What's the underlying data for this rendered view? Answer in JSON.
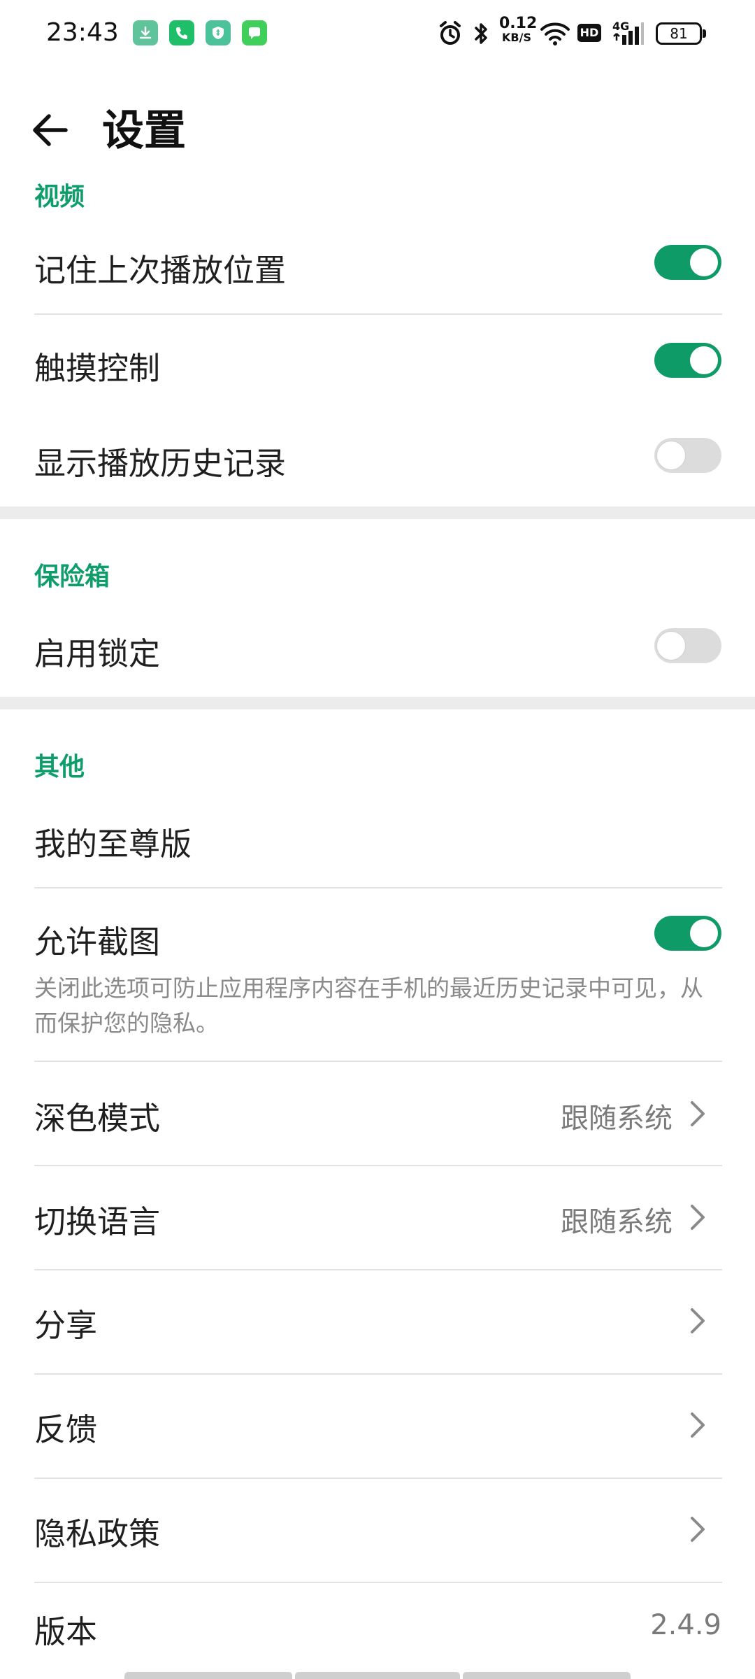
{
  "status_bar": {
    "time": "23:43",
    "notification_icons": [
      {
        "name": "download-icon",
        "color": "#5fc49a"
      },
      {
        "name": "phone-icon",
        "color": "#1fbf6a"
      },
      {
        "name": "security-shield-icon",
        "color": "#4cc29a"
      },
      {
        "name": "message-icon",
        "color": "#3fcf5a"
      }
    ],
    "net_speed_value": "0.12",
    "net_speed_unit": "KB/S",
    "hd_label": "HD",
    "network_type": "4G",
    "battery_level": "81"
  },
  "app_bar": {
    "title": "设置"
  },
  "sections": {
    "video": {
      "header": "视频",
      "items": [
        {
          "label": "记住上次播放位置",
          "switch_on": true
        },
        {
          "label": "触摸控制",
          "switch_on": true
        },
        {
          "label": "显示播放历史记录",
          "switch_on": false
        }
      ]
    },
    "vault": {
      "header": "保险箱",
      "items": [
        {
          "label": "启用锁定",
          "switch_on": false
        }
      ]
    },
    "other": {
      "header": "其他",
      "premium_label": "我的至尊版",
      "screenshot_label": "允许截图",
      "screenshot_switch_on": true,
      "screenshot_desc": "关闭此选项可防止应用程序内容在手机的最近历史记录中可见，从而保护您的隐私。",
      "dark_mode_label": "深色模式",
      "dark_mode_value": "跟随系统",
      "language_label": "切换语言",
      "language_value": "跟随系统",
      "share_label": "分享",
      "feedback_label": "反馈",
      "privacy_label": "隐私政策",
      "version_label": "版本",
      "version_value": "2.4.9"
    }
  },
  "colors": {
    "accent": "#0e9b67",
    "section_header": "#0f9d6b",
    "switch_off": "#dcdcdc"
  }
}
